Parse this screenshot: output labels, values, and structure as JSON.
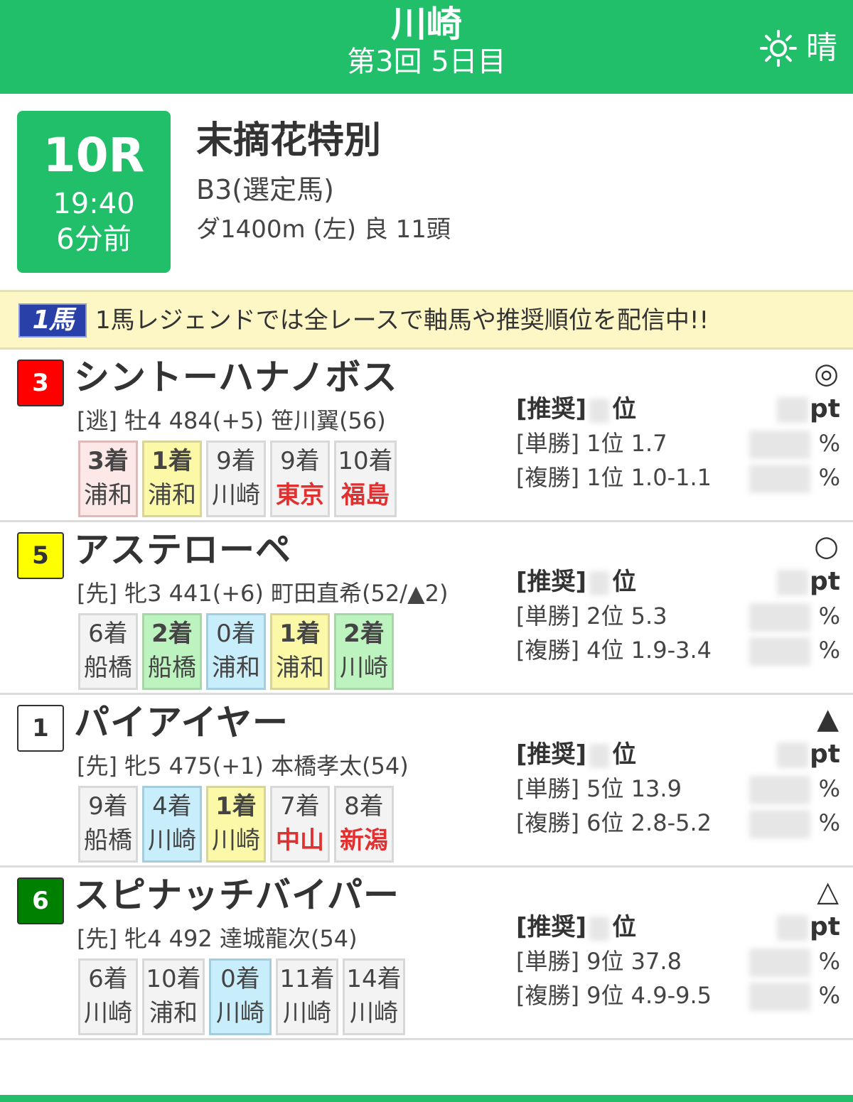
{
  "header": {
    "venue": "川崎",
    "meeting": "第3回 5日目",
    "weather": "晴",
    "weather_icon": "sun-icon",
    "color": "#22bf6a"
  },
  "race": {
    "number": "10R",
    "time": "19:40",
    "countdown": "6分前",
    "name": "末摘花特別",
    "class": "B3(選定馬)",
    "conditions": "ダ1400m (左) 良 11頭"
  },
  "banner": {
    "logo": "1馬",
    "text": "1馬レジェンドでは全レースで軸馬や推奨順位を配信中!!"
  },
  "labels": {
    "rec_label": "[推奨]",
    "rec_unit": "位",
    "pt_unit": "pt",
    "pct_unit": "%"
  },
  "horses": [
    {
      "number": "3",
      "frame_color": "#ff0000",
      "number_color": "#ffffff",
      "name": "シントーハナノボス",
      "info": "[逃] 牡4 484(+5) 笹川翼(56)",
      "mark": "◎",
      "win": "[単勝] 1位 1.7",
      "place": "[複勝] 1位 1.0-1.1",
      "results": [
        {
          "rank": "3着",
          "venue": "浦和"
        },
        {
          "rank": "1着",
          "venue": "浦和"
        },
        {
          "rank": "9着",
          "venue": "川崎"
        },
        {
          "rank": "9着",
          "venue": "東京"
        },
        {
          "rank": "10着",
          "venue": "福島"
        }
      ]
    },
    {
      "number": "5",
      "frame_color": "#ffff00",
      "number_color": "#333333",
      "name": "アステローペ",
      "info": "[先] 牝3 441(+6) 町田直希(52/▲2)",
      "mark": "○",
      "win": "[単勝] 2位 5.3",
      "place": "[複勝] 4位 1.9-3.4",
      "results": [
        {
          "rank": "6着",
          "venue": "船橋"
        },
        {
          "rank": "2着",
          "venue": "船橋"
        },
        {
          "rank": "0着",
          "venue": "浦和"
        },
        {
          "rank": "1着",
          "venue": "浦和"
        },
        {
          "rank": "2着",
          "venue": "川崎"
        }
      ]
    },
    {
      "number": "1",
      "frame_color": "#ffffff",
      "number_color": "#333333",
      "name": "パイアイヤー",
      "info": "[先] 牝5 475(+1) 本橋孝太(54)",
      "mark": "▲",
      "win": "[単勝] 5位 13.9",
      "place": "[複勝] 6位 2.8-5.2",
      "results": [
        {
          "rank": "9着",
          "venue": "船橋"
        },
        {
          "rank": "4着",
          "venue": "川崎"
        },
        {
          "rank": "1着",
          "venue": "川崎"
        },
        {
          "rank": "7着",
          "venue": "中山"
        },
        {
          "rank": "8着",
          "venue": "新潟"
        }
      ]
    },
    {
      "number": "6",
      "frame_color": "#008000",
      "number_color": "#ffffff",
      "name": "スピナッチバイパー",
      "info": "[先] 牝4 492 達城龍次(54)",
      "mark": "△",
      "win": "[単勝] 9位 37.8",
      "place": "[複勝] 9位 4.9-9.5",
      "results": [
        {
          "rank": "6着",
          "venue": "川崎"
        },
        {
          "rank": "10着",
          "venue": "浦和"
        },
        {
          "rank": "0着",
          "venue": "川崎"
        },
        {
          "rank": "11着",
          "venue": "川崎"
        },
        {
          "rank": "14着",
          "venue": "川崎"
        }
      ]
    }
  ]
}
